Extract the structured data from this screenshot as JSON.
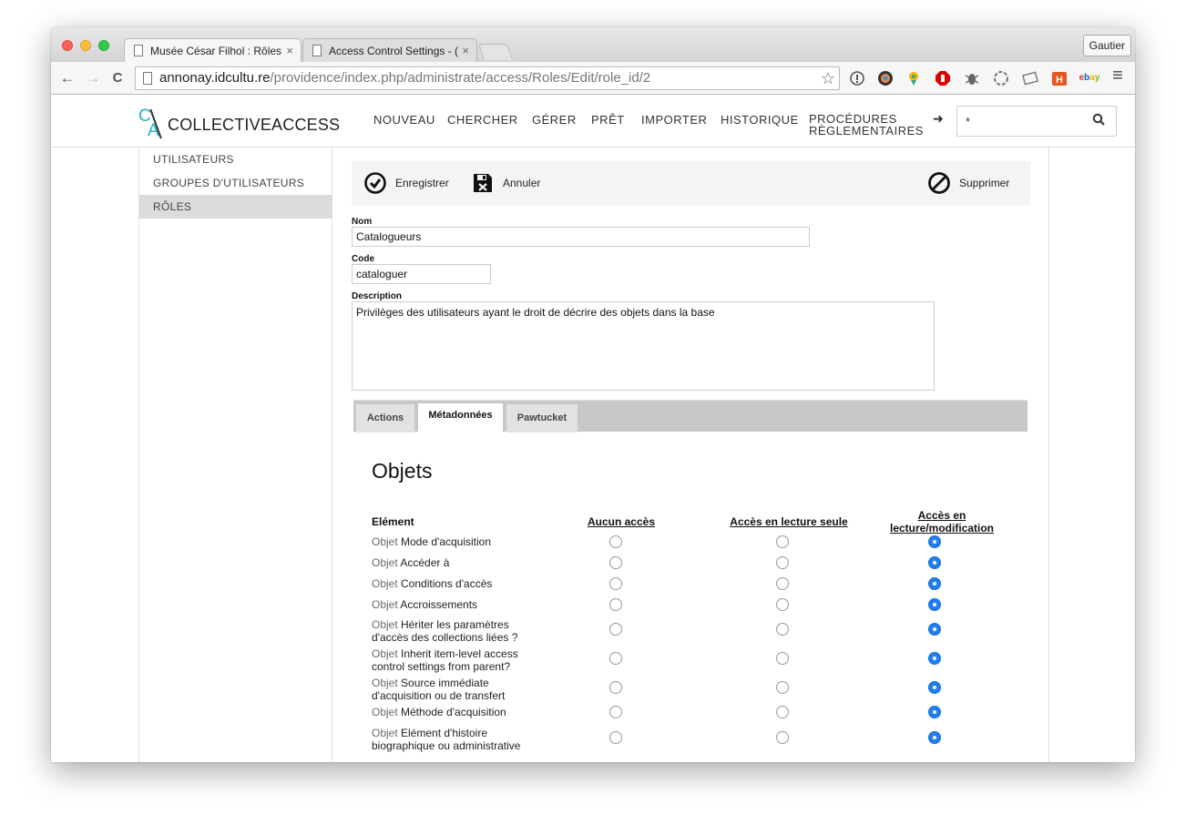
{
  "browser": {
    "tabs": [
      {
        "title": "Musée César Filhol : Rôles",
        "close": "×"
      },
      {
        "title": "Access Control Settings - (",
        "close": "×"
      }
    ],
    "profile": "Gautier",
    "url_host": "annonay.idcultu.re",
    "url_path": "/providence/index.php/administrate/access/Roles/Edit/role_id/2",
    "nav": {
      "back": "←",
      "forward": "→",
      "reload": "C"
    },
    "star": "☆",
    "menu": "≡"
  },
  "app": {
    "logo": {
      "c": "C",
      "a": "A",
      "word": "COLLECTIVEACCESS"
    },
    "nav": [
      "NOUVEAU",
      "CHERCHER",
      "GÉRER",
      "PRÊT",
      "IMPORTER",
      "HISTORIQUE",
      "PROCÉDURES RÈGLEMENTAIRES"
    ],
    "go_arrow": "➜",
    "search_value": "*",
    "search_icon": "search-icon"
  },
  "sidebar": {
    "items": [
      "UTILISATEURS",
      "GROUPES D'UTILISATEURS",
      "RÔLES"
    ],
    "selected": 2
  },
  "toolbar": {
    "save": "Enregistrer",
    "cancel": "Annuler",
    "delete": "Supprimer"
  },
  "form": {
    "name_label": "Nom",
    "name_value": "Catalogueurs",
    "code_label": "Code",
    "code_value": "cataloguer",
    "desc_label": "Description",
    "desc_value": "Privilèges des utilisateurs ayant le droit de décrire des objets dans la base"
  },
  "tabs": [
    "Actions",
    "Métadonnées",
    "Pawtucket"
  ],
  "active_tab": 1,
  "panel": {
    "title": "Objets",
    "col_element": "Elément",
    "col_none": "Aucun accès",
    "col_read": "Accès en lecture seule",
    "col_edit": "Accès en lecture/modification",
    "prefix": "Objet",
    "rows": [
      {
        "label": "Mode d'acquisition",
        "value": "edit"
      },
      {
        "label": "Accéder à",
        "value": "edit"
      },
      {
        "label": "Conditions d'accès",
        "value": "edit"
      },
      {
        "label": "Accroissements",
        "value": "edit"
      },
      {
        "label": "Hériter les paramètres d'accès des collections liées ?",
        "value": "edit"
      },
      {
        "label": "Inherit item-level access control settings from parent?",
        "value": "edit"
      },
      {
        "label": "Source immédiate d'acquisition ou de transfert",
        "value": "edit"
      },
      {
        "label": "Méthode d'acquisition",
        "value": "edit"
      },
      {
        "label": "Elément d'histoire biographique ou administrative",
        "value": "edit"
      }
    ]
  },
  "colors": {
    "accent": "#25b0c8",
    "radio_on": "#1d7ff3"
  }
}
